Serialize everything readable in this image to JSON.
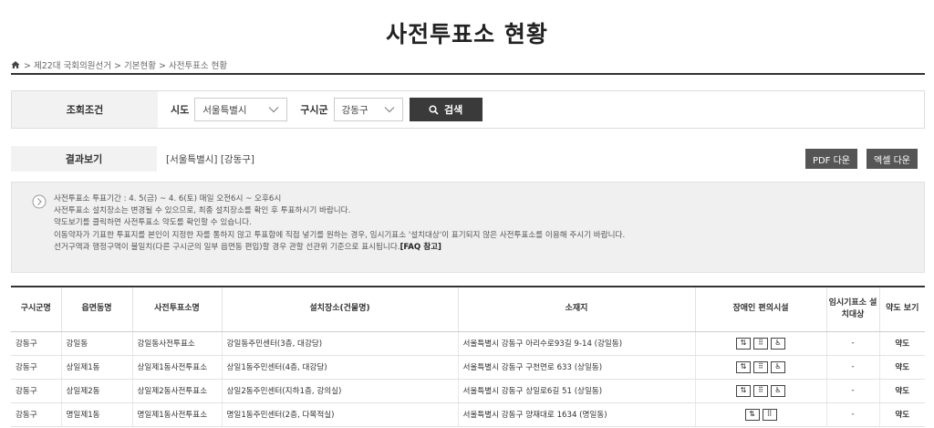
{
  "page": {
    "title": "사전투표소 현황"
  },
  "breadcrumb": {
    "path": "> 제22대 국회의원선거 > 기본현황 > 사전투표소 현황"
  },
  "search": {
    "label": "조회조건",
    "sido_label": "시도",
    "sido_value": "서울특별시",
    "gusigun_label": "구시군",
    "gusigun_value": "강동구",
    "button_label": "검색"
  },
  "result": {
    "label": "결과보기",
    "text": "[서울특별시] [강동구]",
    "pdf_label": "PDF 다운",
    "excel_label": "엑셀 다운"
  },
  "notice": {
    "lines": [
      "사전투표소 투표기간 : 4. 5(금) ~ 4. 6(토) 매일 오전6시 ~ 오후6시",
      "사전투표소 설치장소는 변경될 수 있으므로, 최종 설치장소를 확인 후 투표하시기 바랍니다.",
      "약도보기를 클릭하면 사전투표소 약도를 확인할 수 있습니다.",
      "이동약자가 기표한 투표지를 본인이 지정한 자를 통하지 않고 투표함에 직접 넣기를 원하는 경우, 임시기표소 '설치대상'이 표기되지 않은 사전투표소를 이용해 주시기 바랍니다.",
      "선거구역과 행정구역이 불일치(다른 구시군의 일부 읍면동 편입)할 경우 관할 선관위 기준으로 표시됩니다."
    ],
    "faq": "[FAQ 참고]"
  },
  "table": {
    "headers": [
      "구시군명",
      "읍면동명",
      "사전투표소명",
      "설치장소(건물명)",
      "소재지",
      "장애인 편의시설",
      "임시기표소 설치대상",
      "약도 보기"
    ],
    "rows": [
      {
        "gu": "강동구",
        "dong": "강일동",
        "name": "강일동사전투표소",
        "place": "강일동주민센터(3층, 대강당)",
        "addr": "서울특별시 강동구 아리수로93길 9-14 (강일동)",
        "temp": "-",
        "map": "약도"
      },
      {
        "gu": "강동구",
        "dong": "상일제1동",
        "name": "상일제1동사전투표소",
        "place": "상일1동주민센터(4층, 대강당)",
        "addr": "서울특별시 강동구 구천면로 633 (상일동)",
        "temp": "-",
        "map": "약도"
      },
      {
        "gu": "강동구",
        "dong": "상일제2동",
        "name": "상일제2동사전투표소",
        "place": "상일2동주민센터(지하1층, 강의실)",
        "addr": "서울특별시 강동구 상일로6길 51 (상일동)",
        "temp": "-",
        "map": "약도"
      },
      {
        "gu": "강동구",
        "dong": "명일제1동",
        "name": "명일제1동사전투표소",
        "place": "명일1동주민센터(2층, 다목적실)",
        "addr": "서울특별시 강동구 양재대로 1634 (명일동)",
        "temp": "-",
        "map": "약도"
      }
    ]
  },
  "icons": [
    "home-icon",
    "chevron-down-icon",
    "search-icon",
    "chevron-right-circle-icon",
    "elevator-icon",
    "braille-icon",
    "wheelchair-icon"
  ]
}
